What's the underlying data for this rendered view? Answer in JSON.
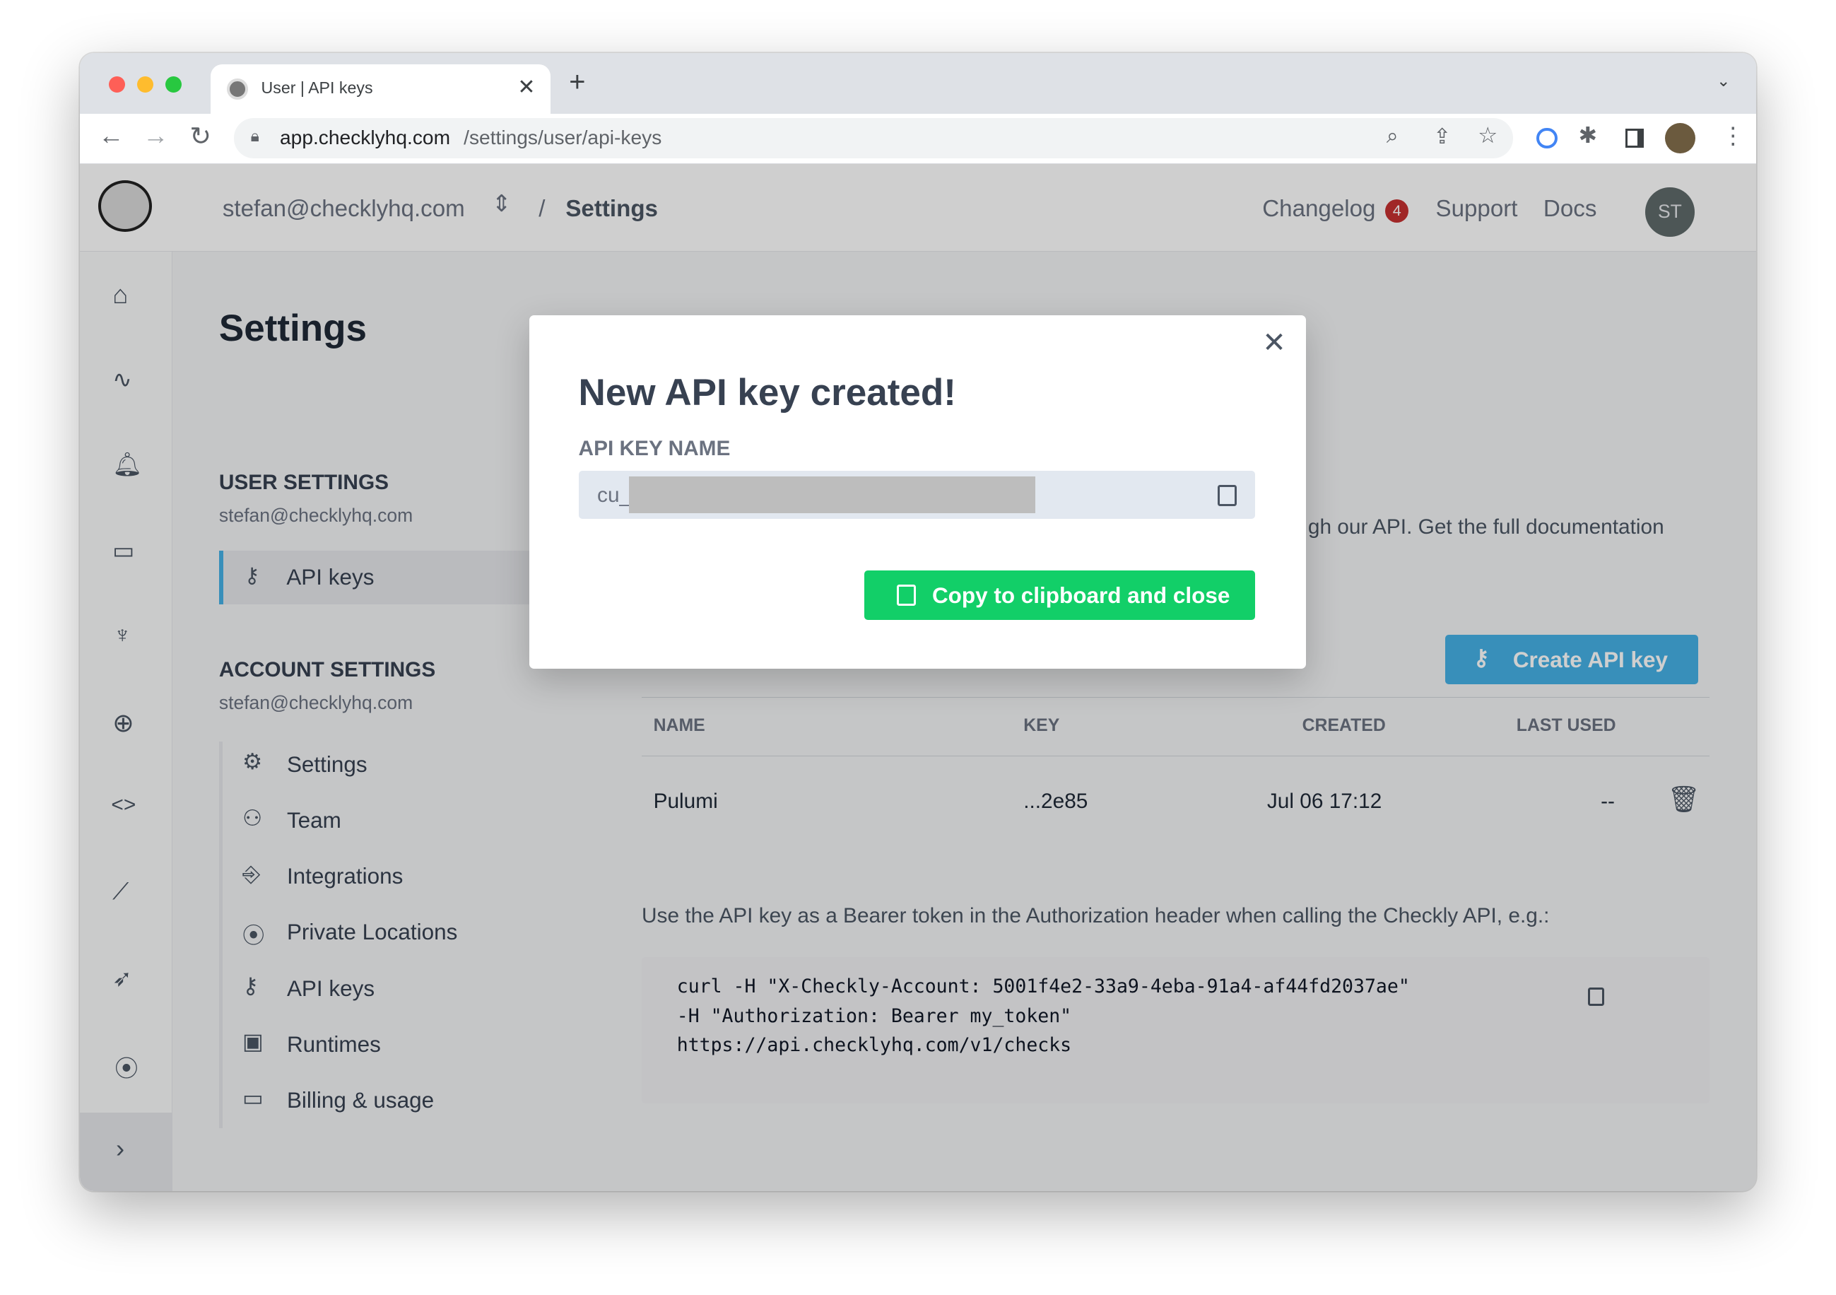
{
  "browser": {
    "tab_title": "User | API keys",
    "url_host": "app.checklyhq.com",
    "url_path": "/settings/user/api-keys"
  },
  "header": {
    "account": "stefan@checklyhq.com",
    "separator": "/",
    "page": "Settings",
    "links": {
      "changelog": "Changelog",
      "changelog_badge": "4",
      "support": "Support",
      "docs": "Docs"
    },
    "avatar": "ST"
  },
  "settings": {
    "title": "Settings",
    "user_section": "USER SETTINGS",
    "user_email": "stefan@checklyhq.com",
    "user_items": [
      {
        "label": "API keys",
        "icon": "key-icon",
        "active": true
      }
    ],
    "account_section": "ACCOUNT SETTINGS",
    "account_email": "stefan@checklyhq.com",
    "account_items": [
      {
        "label": "Settings"
      },
      {
        "label": "Team"
      },
      {
        "label": "Integrations"
      },
      {
        "label": "Private Locations"
      },
      {
        "label": "API keys"
      },
      {
        "label": "Runtimes"
      },
      {
        "label": "Billing & usage"
      }
    ]
  },
  "main": {
    "intro_fragment": "gh our API. Get the full documentation",
    "create_button": "Create API key",
    "table": {
      "headers": [
        "NAME",
        "KEY",
        "CREATED",
        "LAST USED"
      ],
      "rows": [
        {
          "name": "Pulumi",
          "key": "...2e85",
          "created": "Jul 06 17:12",
          "last_used": "--"
        }
      ]
    },
    "usage_text": "Use the API key as a Bearer token in the Authorization header when calling the Checkly API, e.g.:",
    "code": [
      "curl -H \"X-Checkly-Account: 5001f4e2-33a9-4eba-91a4-af44fd2037ae\"",
      "    -H \"Authorization: Bearer my_token\"",
      "    https://api.checklyhq.com/v1/checks"
    ]
  },
  "modal": {
    "title": "New API key created!",
    "field_label": "API KEY NAME",
    "field_value": "cu_",
    "button": "Copy to clipboard and close"
  },
  "colors": {
    "accent": "#45b0e6",
    "success": "#12cf68",
    "badge": "#c53030"
  }
}
